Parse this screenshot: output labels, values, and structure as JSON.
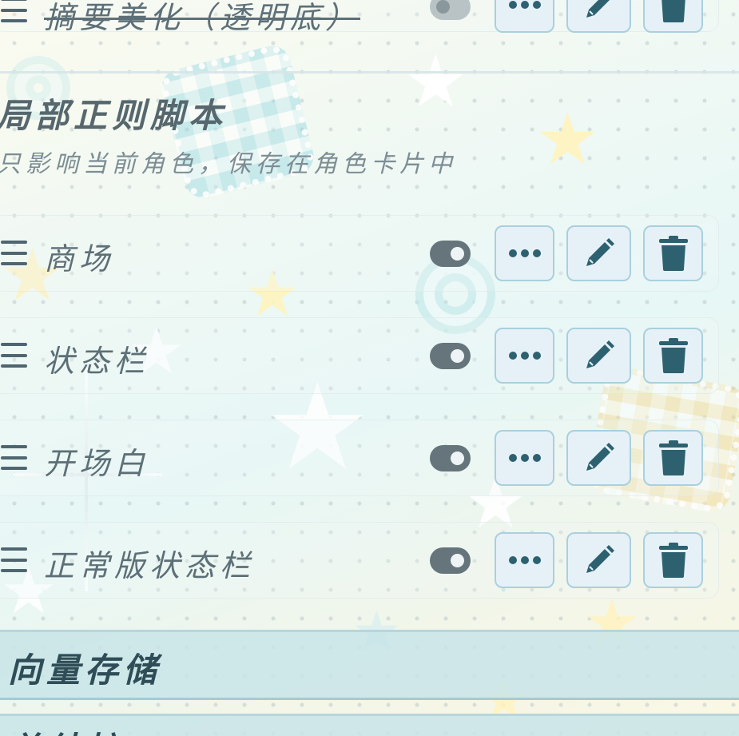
{
  "top_row": {
    "label": "摘要美化（透明底）",
    "enabled": false
  },
  "local_regex": {
    "title": "局部正则脚本",
    "description": "只影响当前角色，保存在角色卡片中",
    "scripts": [
      {
        "label": "商场",
        "enabled": true
      },
      {
        "label": "状态栏",
        "enabled": true
      },
      {
        "label": "开场白",
        "enabled": true
      },
      {
        "label": "正常版状态栏",
        "enabled": true
      }
    ]
  },
  "sections": {
    "vector_storage": "向量存储",
    "next_section": "总结扩"
  },
  "icons": {
    "drag": "drag-handle-icon",
    "more": "ellipsis-icon",
    "edit": "pencil-icon",
    "delete": "trash-icon"
  },
  "colors": {
    "accent": "#2d6170",
    "button_bg": "#e6f1f7",
    "button_border": "#a9d0de",
    "toggle_on": "#66757b",
    "section_header_bg": "#c8e4e8"
  }
}
